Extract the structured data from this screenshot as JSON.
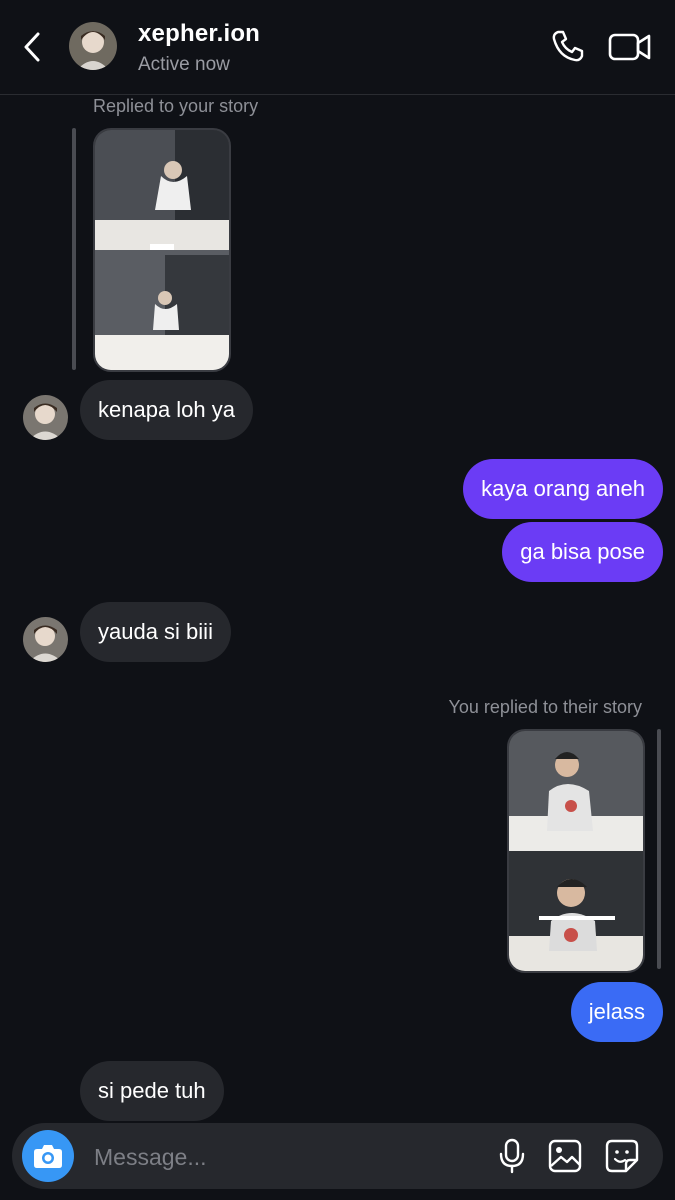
{
  "header": {
    "username": "xepher.ion",
    "status": "Active now"
  },
  "messages": {
    "story_reply_in_label": "Replied to your story",
    "m1": "kenapa loh ya",
    "m2": "kaya orang aneh",
    "m3": "ga bisa pose",
    "m4": "yauda si biii",
    "story_reply_out_label": "You replied to their story",
    "m5": "jelass",
    "m6": "si pede tuh"
  },
  "composer": {
    "placeholder": "Message..."
  },
  "colors": {
    "background": "#0f1116",
    "incoming_bubble": "#26282d",
    "outgoing_purple": "#6b3cf5",
    "outgoing_blue": "#3a6bf5",
    "camera_button": "#3797f5"
  },
  "icons": [
    "back-arrow-icon",
    "phone-icon",
    "video-camera-icon",
    "camera-icon",
    "microphone-icon",
    "gallery-icon",
    "sticker-icon"
  ]
}
